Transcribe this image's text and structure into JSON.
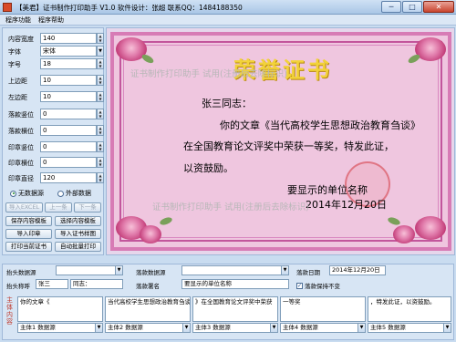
{
  "window": {
    "title": "【美君】证书制作打印助手 V1.0    软件设计：张超  联系QQ：1484188350",
    "min_label": "─",
    "max_label": "□",
    "close_label": "✕"
  },
  "menu": {
    "items": [
      "程序功能",
      "程序帮助"
    ]
  },
  "settings": {
    "rows": [
      {
        "label": "内容宽度",
        "value": "140"
      },
      {
        "label": "字体",
        "value": "宋体"
      },
      {
        "label": "字号",
        "value": "18"
      },
      {
        "label": "上边距",
        "value": "10"
      },
      {
        "label": "左边距",
        "value": "10"
      },
      {
        "label": "落款竖位",
        "value": "0"
      },
      {
        "label": "落款横位",
        "value": "0"
      },
      {
        "label": "印章竖位",
        "value": "0"
      },
      {
        "label": "印章横位",
        "value": "0"
      },
      {
        "label": "印章直径",
        "value": "120"
      }
    ],
    "radio_no_source": "无数据源",
    "radio_external": "外部数据",
    "buttons": {
      "import_excel": "导入EXCEL",
      "prev": "上一条",
      "next": "下一条",
      "save_template": "保存内容模板",
      "choose_template": "选择内容模板",
      "import_seal": "导入印章",
      "import_cert_bg": "导入证书样图",
      "print_current": "打印当前证书",
      "auto_batch": "自动批量打印"
    }
  },
  "certificate": {
    "title": "荣誉证书",
    "watermark_top": "证书制作打印助手    试用(注册后去除标识)",
    "watermark_bottom": "证书制作打印助手    试用(注册后去除标识)",
    "salutation": "张三同志：",
    "body_lines": [
      "你的文章《当代高校学生思想政治教育刍谈》",
      "在全国教育论文评奖中荣获一等奖，特发此证，",
      "以资鼓励。"
    ],
    "unit": "要显示的单位名称",
    "date": "2014年12月20日"
  },
  "bottom": {
    "header_source_label": "抬头数据源",
    "sign_source_label": "落款数据源",
    "header_name_label": "抬头称呼",
    "header_name_value": "张三",
    "header_suffix_value": "同志：",
    "sign_name_label": "落款署名",
    "sign_name_value": "要显示的单位名称",
    "sign_date_label": "落款日期",
    "sign_date_value": "2014年12月20日",
    "keep_sign_label": "落款保持不变",
    "keep_sign_checked": "✓",
    "body_vertical_label": "主体内容",
    "body_cells": [
      "你的文章《",
      "当代高校学生思想政治教育刍谈",
      "》在全国教育论文评奖中荣获",
      "一等奖",
      "，特发此证，以资鼓励。"
    ],
    "body_sources": [
      "主体1 数据源",
      "主体2 数据源",
      "主体3 数据源",
      "主体4 数据源",
      "主体5 数据源"
    ]
  }
}
